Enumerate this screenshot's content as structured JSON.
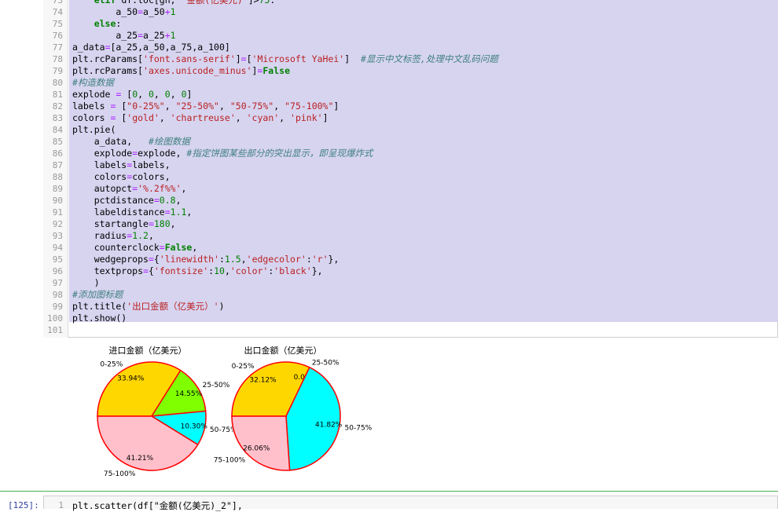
{
  "code_lines": [
    {
      "n": "73",
      "parts": [
        [
          "    ",
          ""
        ],
        [
          "elif",
          "kw"
        ],
        [
          " df.loc[gn, ",
          "",
          ""
        ],
        [
          "\"金额(亿美元)\"",
          "str"
        ],
        [
          "]>",
          ""
        ],
        [
          "75",
          "num"
        ],
        [
          ":",
          ""
        ]
      ]
    },
    {
      "n": "74",
      "parts": [
        [
          "        a_50",
          ""
        ],
        [
          "=",
          "op"
        ],
        [
          "a_50",
          ""
        ],
        [
          "+",
          "op"
        ],
        [
          "1",
          "num"
        ]
      ]
    },
    {
      "n": "75",
      "parts": [
        [
          "    ",
          ""
        ],
        [
          "else",
          "kw"
        ],
        [
          ":",
          ""
        ]
      ]
    },
    {
      "n": "76",
      "parts": [
        [
          "        a_25",
          ""
        ],
        [
          "=",
          "op"
        ],
        [
          "a_25",
          ""
        ],
        [
          "+",
          "op"
        ],
        [
          "1",
          "num"
        ]
      ]
    },
    {
      "n": "77",
      "parts": [
        [
          "a_data",
          ""
        ],
        [
          "=",
          "op"
        ],
        [
          "[a_25,a_50,a_75,a_100]",
          ""
        ]
      ]
    },
    {
      "n": "78",
      "parts": [
        [
          "plt.rcParams[",
          ""
        ],
        [
          "'font.sans-serif'",
          "str"
        ],
        [
          "]",
          ""
        ],
        [
          "=",
          "op"
        ],
        [
          "[",
          ""
        ],
        [
          "'Microsoft YaHei'",
          "str"
        ],
        [
          "]  ",
          ""
        ],
        [
          "#显示中文标签,处理中文乱码问题",
          "cm"
        ]
      ]
    },
    {
      "n": "79",
      "parts": [
        [
          "plt.rcParams[",
          ""
        ],
        [
          "'axes.unicode_minus'",
          "str"
        ],
        [
          "]",
          ""
        ],
        [
          "=",
          "op"
        ],
        [
          "False",
          "kw"
        ]
      ]
    },
    {
      "n": "80",
      "parts": [
        [
          "#构造数据",
          "cm"
        ]
      ]
    },
    {
      "n": "81",
      "parts": [
        [
          "explode ",
          ""
        ],
        [
          "=",
          "op"
        ],
        [
          " [",
          ""
        ],
        [
          "0",
          "num"
        ],
        [
          ", ",
          ""
        ],
        [
          "0",
          "num"
        ],
        [
          ", ",
          ""
        ],
        [
          "0",
          "num"
        ],
        [
          ", ",
          ""
        ],
        [
          "0",
          "num"
        ],
        [
          "]",
          ""
        ]
      ]
    },
    {
      "n": "82",
      "parts": [
        [
          "labels ",
          ""
        ],
        [
          "=",
          "op"
        ],
        [
          " [",
          ""
        ],
        [
          "\"0-25%\"",
          "str"
        ],
        [
          ", ",
          ""
        ],
        [
          "\"25-50%\"",
          "str"
        ],
        [
          ", ",
          ""
        ],
        [
          "\"50-75%\"",
          "str"
        ],
        [
          ", ",
          ""
        ],
        [
          "\"75-100%\"",
          "str"
        ],
        [
          "]",
          ""
        ]
      ]
    },
    {
      "n": "83",
      "parts": [
        [
          "colors ",
          ""
        ],
        [
          "=",
          "op"
        ],
        [
          " [",
          ""
        ],
        [
          "'gold'",
          "str"
        ],
        [
          ", ",
          ""
        ],
        [
          "'chartreuse'",
          "str"
        ],
        [
          ", ",
          ""
        ],
        [
          "'cyan'",
          "str"
        ],
        [
          ", ",
          ""
        ],
        [
          "'pink'",
          "str"
        ],
        [
          "]",
          ""
        ]
      ]
    },
    {
      "n": "84",
      "parts": [
        [
          "plt.pie(",
          ""
        ]
      ]
    },
    {
      "n": "85",
      "parts": [
        [
          "    a_data,   ",
          ""
        ],
        [
          "#绘图数据",
          "cm"
        ]
      ]
    },
    {
      "n": "86",
      "parts": [
        [
          "    explode",
          ""
        ],
        [
          "=",
          "op"
        ],
        [
          "explode, ",
          ""
        ],
        [
          "#指定饼图某些部分的突出显示，即呈现爆炸式",
          "cm"
        ]
      ]
    },
    {
      "n": "87",
      "parts": [
        [
          "    labels",
          ""
        ],
        [
          "=",
          "op"
        ],
        [
          "labels,",
          ""
        ]
      ]
    },
    {
      "n": "88",
      "parts": [
        [
          "    colors",
          ""
        ],
        [
          "=",
          "op"
        ],
        [
          "colors,",
          ""
        ]
      ]
    },
    {
      "n": "89",
      "parts": [
        [
          "    autopct",
          ""
        ],
        [
          "=",
          "op"
        ],
        [
          "'%.2f%%'",
          "str"
        ],
        [
          ",",
          ""
        ]
      ]
    },
    {
      "n": "90",
      "parts": [
        [
          "    pctdistance",
          ""
        ],
        [
          "=",
          "op"
        ],
        [
          "0.8",
          "num"
        ],
        [
          ",",
          ""
        ]
      ]
    },
    {
      "n": "91",
      "parts": [
        [
          "    labeldistance",
          ""
        ],
        [
          "=",
          "op"
        ],
        [
          "1.1",
          "num"
        ],
        [
          ",",
          ""
        ]
      ]
    },
    {
      "n": "92",
      "parts": [
        [
          "    startangle",
          ""
        ],
        [
          "=",
          "op"
        ],
        [
          "180",
          "num"
        ],
        [
          ",",
          ""
        ]
      ]
    },
    {
      "n": "93",
      "parts": [
        [
          "    radius",
          ""
        ],
        [
          "=",
          "op"
        ],
        [
          "1.2",
          "num"
        ],
        [
          ",",
          ""
        ]
      ]
    },
    {
      "n": "94",
      "parts": [
        [
          "    counterclock",
          ""
        ],
        [
          "=",
          "op"
        ],
        [
          "False",
          "kw"
        ],
        [
          ",",
          ""
        ]
      ]
    },
    {
      "n": "95",
      "parts": [
        [
          "    wedgeprops",
          ""
        ],
        [
          "=",
          "op"
        ],
        [
          "{",
          ""
        ],
        [
          "'linewidth'",
          "str"
        ],
        [
          ":",
          ""
        ],
        [
          "1.5",
          "num"
        ],
        [
          ",",
          ""
        ],
        [
          "'edgecolor'",
          "str"
        ],
        [
          ":",
          ""
        ],
        [
          "'r'",
          "str"
        ],
        [
          "},",
          ""
        ]
      ]
    },
    {
      "n": "96",
      "parts": [
        [
          "    textprops",
          ""
        ],
        [
          "=",
          "op"
        ],
        [
          "{",
          ""
        ],
        [
          "'fontsize'",
          "str"
        ],
        [
          ":",
          ""
        ],
        [
          "10",
          "num"
        ],
        [
          ",",
          ""
        ],
        [
          "'color'",
          "str"
        ],
        [
          ":",
          ""
        ],
        [
          "'black'",
          "str"
        ],
        [
          "},",
          ""
        ]
      ]
    },
    {
      "n": "97",
      "parts": [
        [
          "    )",
          ""
        ]
      ]
    },
    {
      "n": "98",
      "parts": [
        [
          "#添加图标题",
          "cm"
        ]
      ]
    },
    {
      "n": "99",
      "parts": [
        [
          "plt.title(",
          ""
        ],
        [
          "'出口金额（亿美元）'",
          "str"
        ],
        [
          ")",
          ""
        ]
      ]
    },
    {
      "n": "100",
      "parts": [
        [
          "plt.show()",
          ""
        ]
      ]
    },
    {
      "n": "101",
      "parts": []
    }
  ],
  "next_cell": {
    "prompt": "[125]:",
    "line_no": "1",
    "code": "plt.scatter(df[\"金额(亿美元)_2\"],"
  },
  "colors": {
    "gold": "#ffd700",
    "chartreuse": "#7fff00",
    "cyan": "#00ffff",
    "pink": "#ffc0cb",
    "edge": "#ff0000"
  },
  "chart_data": [
    {
      "type": "pie",
      "title": "进口金额（亿美元）",
      "labels": [
        "0-25%",
        "25-50%",
        "50-75%",
        "75-100%"
      ],
      "values": [
        33.94,
        14.55,
        10.3,
        41.21
      ],
      "pct_labels": [
        "33.94%",
        "14.55%",
        "10.30%",
        "41.21%"
      ]
    },
    {
      "type": "pie",
      "title": "出口金额（亿美元）",
      "labels": [
        "0-25%",
        "25-50%",
        "50-75%",
        "75-100%"
      ],
      "values": [
        32.12,
        0.0,
        41.82,
        26.06
      ],
      "pct_labels": [
        "32.12%",
        "0.00%",
        "41.82%",
        "26.06%"
      ]
    }
  ]
}
